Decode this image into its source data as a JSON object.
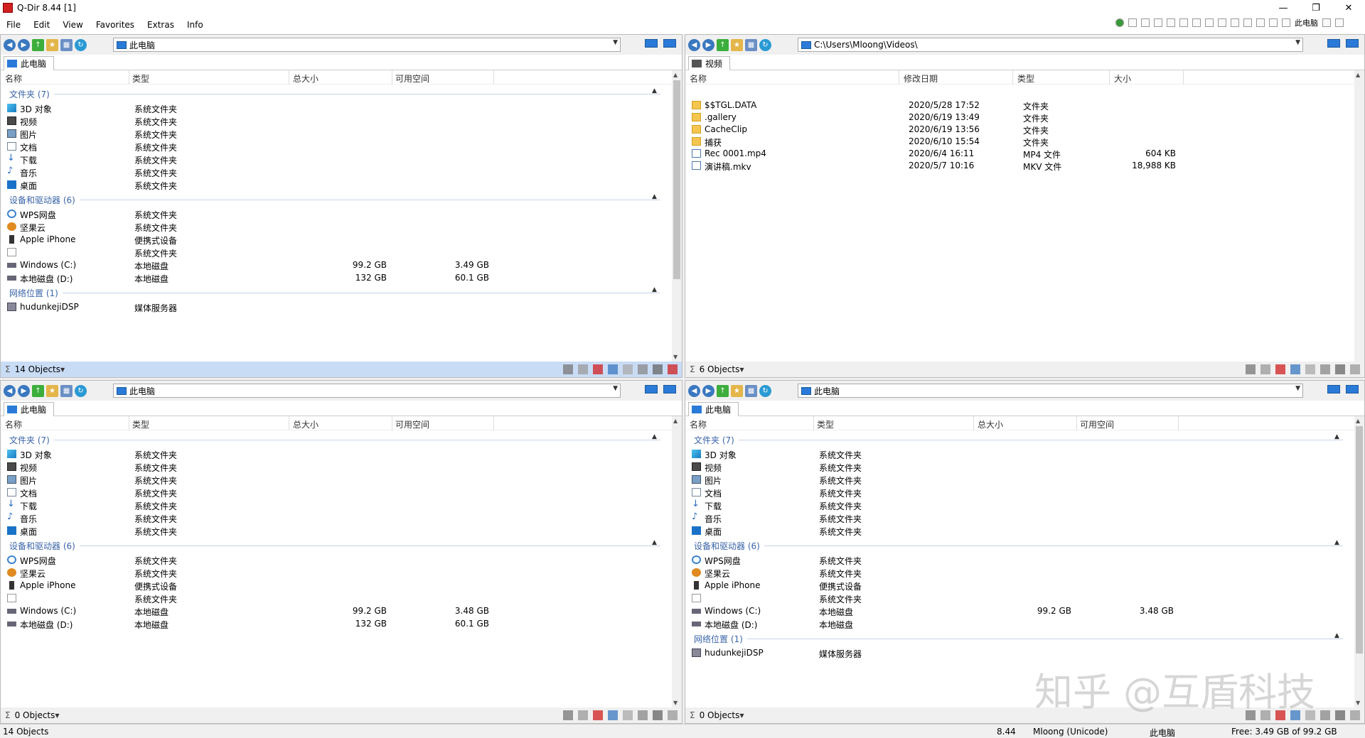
{
  "window": {
    "title": "Q-Dir 8.44 [1]",
    "minimize": "—",
    "restore": "❐",
    "close": "✕"
  },
  "menu": [
    "File",
    "Edit",
    "View",
    "Favorites",
    "Extras",
    "Info"
  ],
  "toolbar_global": {
    "computer_label": "此电脑"
  },
  "columns": {
    "name": "名称",
    "type": "类型",
    "total": "总大小",
    "free": "可用空间",
    "modified": "修改日期",
    "size": "大小"
  },
  "panes": [
    {
      "address": "此电脑",
      "tab": "此电脑",
      "groups": [
        {
          "label": "文件夹 (7)",
          "rows": [
            {
              "name": "3D 对象",
              "type": "系统文件夹",
              "icon": "cube-icon"
            },
            {
              "name": "视频",
              "type": "系统文件夹",
              "icon": "video-folder-icon"
            },
            {
              "name": "图片",
              "type": "系统文件夹",
              "icon": "pictures-icon"
            },
            {
              "name": "文档",
              "type": "系统文件夹",
              "icon": "documents-icon"
            },
            {
              "name": "下载",
              "type": "系统文件夹",
              "icon": "download-icon"
            },
            {
              "name": "音乐",
              "type": "系统文件夹",
              "icon": "music-icon"
            },
            {
              "name": "桌面",
              "type": "系统文件夹",
              "icon": "desktop-icon"
            }
          ]
        },
        {
          "label": "设备和驱动器 (6)",
          "rows": [
            {
              "name": "WPS网盘",
              "type": "系统文件夹",
              "icon": "cloud-icon"
            },
            {
              "name": "坚果云",
              "type": "系统文件夹",
              "icon": "nut-icon"
            },
            {
              "name": "Apple iPhone",
              "type": "便携式设备",
              "icon": "phone-icon"
            },
            {
              "name": "",
              "type": "系统文件夹",
              "icon": "blank-icon"
            },
            {
              "name": "Windows (C:)",
              "type": "本地磁盘",
              "total": "99.2 GB",
              "free": "3.49 GB",
              "icon": "drive-icon"
            },
            {
              "name": "本地磁盘 (D:)",
              "type": "本地磁盘",
              "total": "132 GB",
              "free": "60.1 GB",
              "icon": "drive-icon"
            }
          ]
        },
        {
          "label": "网络位置 (1)",
          "rows": [
            {
              "name": "hudunkejiDSP",
              "type": "媒体服务器",
              "icon": "media-server-icon"
            }
          ]
        }
      ],
      "status": "14 Objects"
    },
    {
      "address": "C:\\Users\\Mloong\\Videos\\",
      "tab": "视频",
      "files": [
        {
          "name": "$$TGL.DATA",
          "modified": "2020/5/28 17:52",
          "type": "文件夹",
          "size": ""
        },
        {
          "name": ".gallery",
          "modified": "2020/6/19 13:49",
          "type": "文件夹",
          "size": ""
        },
        {
          "name": "CacheClip",
          "modified": "2020/6/19 13:56",
          "type": "文件夹",
          "size": ""
        },
        {
          "name": "捕获",
          "modified": "2020/6/10 15:54",
          "type": "文件夹",
          "size": ""
        },
        {
          "name": "Rec 0001.mp4",
          "modified": "2020/6/4 16:11",
          "type": "MP4 文件",
          "size": "604 KB"
        },
        {
          "name": "演讲稿.mkv",
          "modified": "2020/5/7 10:16",
          "type": "MKV 文件",
          "size": "18,988 KB"
        }
      ],
      "status": "6 Objects"
    },
    {
      "address": "此电脑",
      "tab": "此电脑",
      "groups": [
        {
          "label": "文件夹 (7)",
          "rows": [
            {
              "name": "3D 对象",
              "type": "系统文件夹",
              "icon": "cube-icon"
            },
            {
              "name": "视频",
              "type": "系统文件夹",
              "icon": "video-folder-icon"
            },
            {
              "name": "图片",
              "type": "系统文件夹",
              "icon": "pictures-icon"
            },
            {
              "name": "文档",
              "type": "系统文件夹",
              "icon": "documents-icon"
            },
            {
              "name": "下载",
              "type": "系统文件夹",
              "icon": "download-icon"
            },
            {
              "name": "音乐",
              "type": "系统文件夹",
              "icon": "music-icon"
            },
            {
              "name": "桌面",
              "type": "系统文件夹",
              "icon": "desktop-icon"
            }
          ]
        },
        {
          "label": "设备和驱动器 (6)",
          "rows": [
            {
              "name": "WPS网盘",
              "type": "系统文件夹",
              "icon": "cloud-icon"
            },
            {
              "name": "坚果云",
              "type": "系统文件夹",
              "icon": "nut-icon"
            },
            {
              "name": "Apple iPhone",
              "type": "便携式设备",
              "icon": "phone-icon"
            },
            {
              "name": "",
              "type": "系统文件夹",
              "icon": "blank-icon"
            },
            {
              "name": "Windows (C:)",
              "type": "本地磁盘",
              "total": "99.2 GB",
              "free": "3.48 GB",
              "icon": "drive-icon"
            },
            {
              "name": "本地磁盘 (D:)",
              "type": "本地磁盘",
              "total": "132 GB",
              "free": "60.1 GB",
              "icon": "drive-icon"
            }
          ]
        }
      ],
      "status": "0 Objects"
    },
    {
      "address": "此电脑",
      "tab": "此电脑",
      "groups": [
        {
          "label": "文件夹 (7)",
          "rows": [
            {
              "name": "3D 对象",
              "type": "系统文件夹",
              "icon": "cube-icon"
            },
            {
              "name": "视频",
              "type": "系统文件夹",
              "icon": "video-folder-icon"
            },
            {
              "name": "图片",
              "type": "系统文件夹",
              "icon": "pictures-icon"
            },
            {
              "name": "文档",
              "type": "系统文件夹",
              "icon": "documents-icon"
            },
            {
              "name": "下载",
              "type": "系统文件夹",
              "icon": "download-icon"
            },
            {
              "name": "音乐",
              "type": "系统文件夹",
              "icon": "music-icon"
            },
            {
              "name": "桌面",
              "type": "系统文件夹",
              "icon": "desktop-icon"
            }
          ]
        },
        {
          "label": "设备和驱动器 (6)",
          "rows": [
            {
              "name": "WPS网盘",
              "type": "系统文件夹",
              "icon": "cloud-icon"
            },
            {
              "name": "坚果云",
              "type": "系统文件夹",
              "icon": "nut-icon"
            },
            {
              "name": "Apple iPhone",
              "type": "便携式设备",
              "icon": "phone-icon"
            },
            {
              "name": "",
              "type": "系统文件夹",
              "icon": "blank-icon"
            },
            {
              "name": "Windows (C:)",
              "type": "本地磁盘",
              "total": "99.2 GB",
              "free": "3.48 GB",
              "icon": "drive-icon"
            },
            {
              "name": "本地磁盘 (D:)",
              "type": "本地磁盘",
              "total": "",
              "free": "",
              "icon": "drive-icon"
            }
          ]
        },
        {
          "label": "网络位置 (1)",
          "rows": [
            {
              "name": "hudunkejiDSP",
              "type": "媒体服务器",
              "icon": "media-server-icon"
            }
          ]
        }
      ],
      "status": "0 Objects"
    }
  ],
  "statusbar": {
    "objects": "14 Objects",
    "version": "8.44",
    "user": "Mloong (Unicode)",
    "location": "此电脑",
    "free": "Free: 3.49 GB of 99.2 GB"
  },
  "watermark": "知乎 @互盾科技",
  "colors": {
    "accent": "#2a7ad8",
    "active_status": "#c9dcf5",
    "group_label": "#3a64a8",
    "close_red": "#d02020"
  }
}
